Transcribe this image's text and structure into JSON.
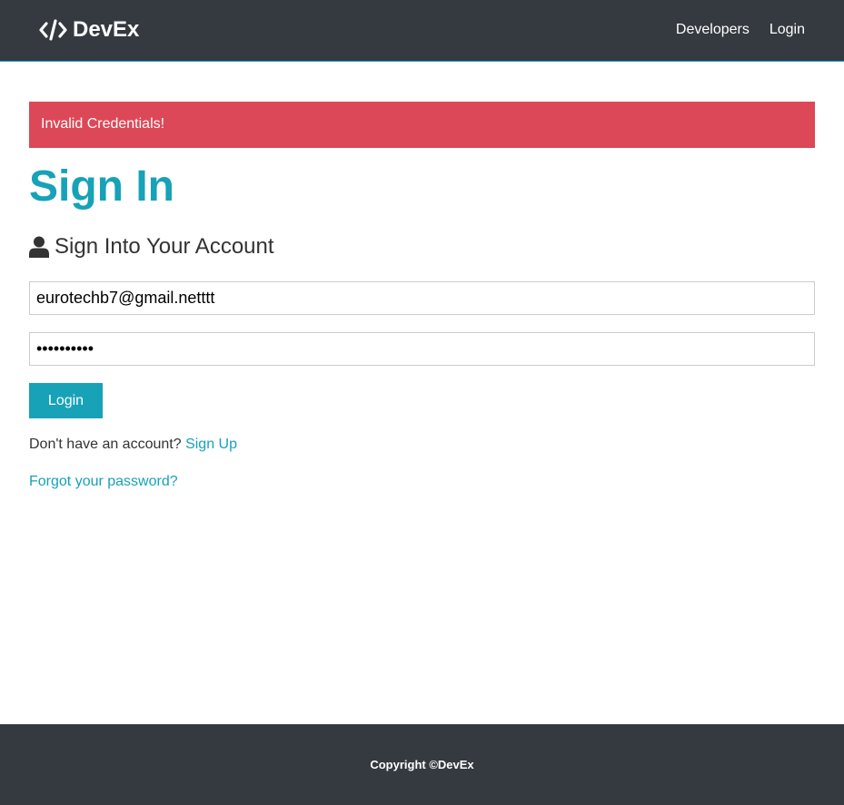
{
  "navbar": {
    "brand": "DevEx",
    "links": [
      "Developers",
      "Login"
    ]
  },
  "alert": {
    "message": "Invalid Credentials!",
    "color": "#dc4857"
  },
  "page": {
    "title": "Sign In",
    "lead": "Sign Into Your Account"
  },
  "form": {
    "email_value": "eurotechb7@gmail.netttt",
    "password_value": "••••••••••",
    "submit_label": "Login"
  },
  "signup": {
    "prompt": "Don't have an account?",
    "link_label": "Sign Up"
  },
  "forgot": {
    "link_label": "Forgot your password?"
  },
  "footer": {
    "copyright": "Copyright ©DevEx"
  },
  "icons": {
    "brand_icon": "code-icon",
    "lead_icon": "user-icon"
  },
  "colors": {
    "navbar": "#343a40",
    "accent": "#17a2b8",
    "danger": "#dc4857"
  }
}
